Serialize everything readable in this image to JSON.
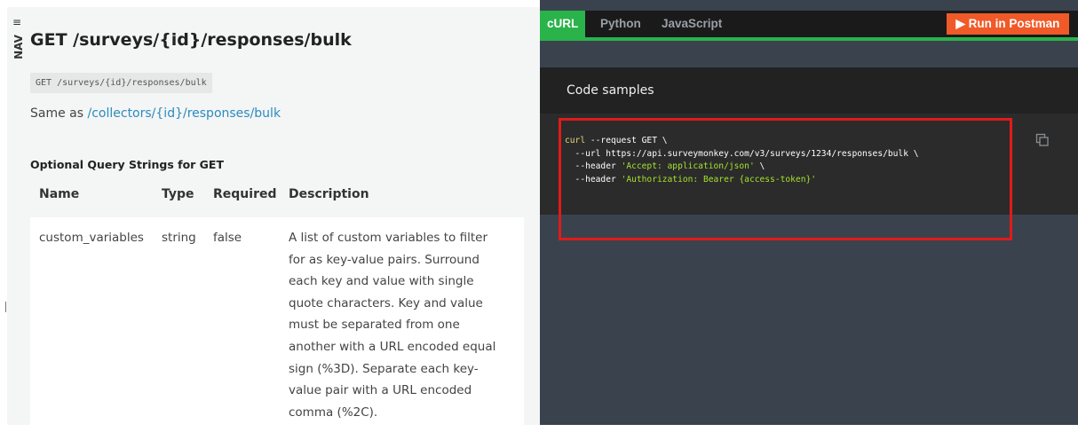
{
  "nav": {
    "icon": "≡",
    "label": "NAV"
  },
  "page": {
    "title": "GET /surveys/{id}/responses/bulk",
    "endpoint_code": "GET /surveys/{id}/responses/bulk",
    "same_as_prefix": "Same as ",
    "same_as_link": "/collectors/{id}/responses/bulk",
    "optional_heading": "Optional Query Strings for GET"
  },
  "table": {
    "headers": [
      "Name",
      "Type",
      "Required",
      "Description"
    ],
    "rows": [
      {
        "name": "custom_variables",
        "type": "string",
        "required": "false",
        "description_lines": [
          "A list of custom variables to filter",
          "for as key-value pairs. Surround",
          "each key and value with single",
          "quote characters. Key and value",
          "must be separated from one",
          "another with a URL encoded equal",
          "sign (%3D). Separate each key-",
          "value pair with a URL encoded",
          "comma (%2C)."
        ]
      }
    ]
  },
  "code_panel": {
    "tabs": [
      "cURL",
      "Python",
      "JavaScript"
    ],
    "active_tab": "cURL",
    "run_button": "▶ Run in Postman",
    "samples_title": "Code samples",
    "code": {
      "line1_cmd": "curl",
      "line1_rest": " --request GET \\",
      "line2": "  --url https://api.surveymonkey.com/v3/surveys/1234/responses/bulk \\",
      "line3_pre": "  --header ",
      "line3_str": "'Accept: application/json'",
      "line3_post": " \\",
      "line4_pre": "  --header ",
      "line4_str": "'Authorization: Bearer {access-token}'"
    },
    "copy_icon": "copy-icon"
  },
  "colors": {
    "accent_green": "#29b34a",
    "run_orange": "#f05a28",
    "link_blue": "#2a8bbf",
    "highlight_red": "#e01b1b"
  }
}
